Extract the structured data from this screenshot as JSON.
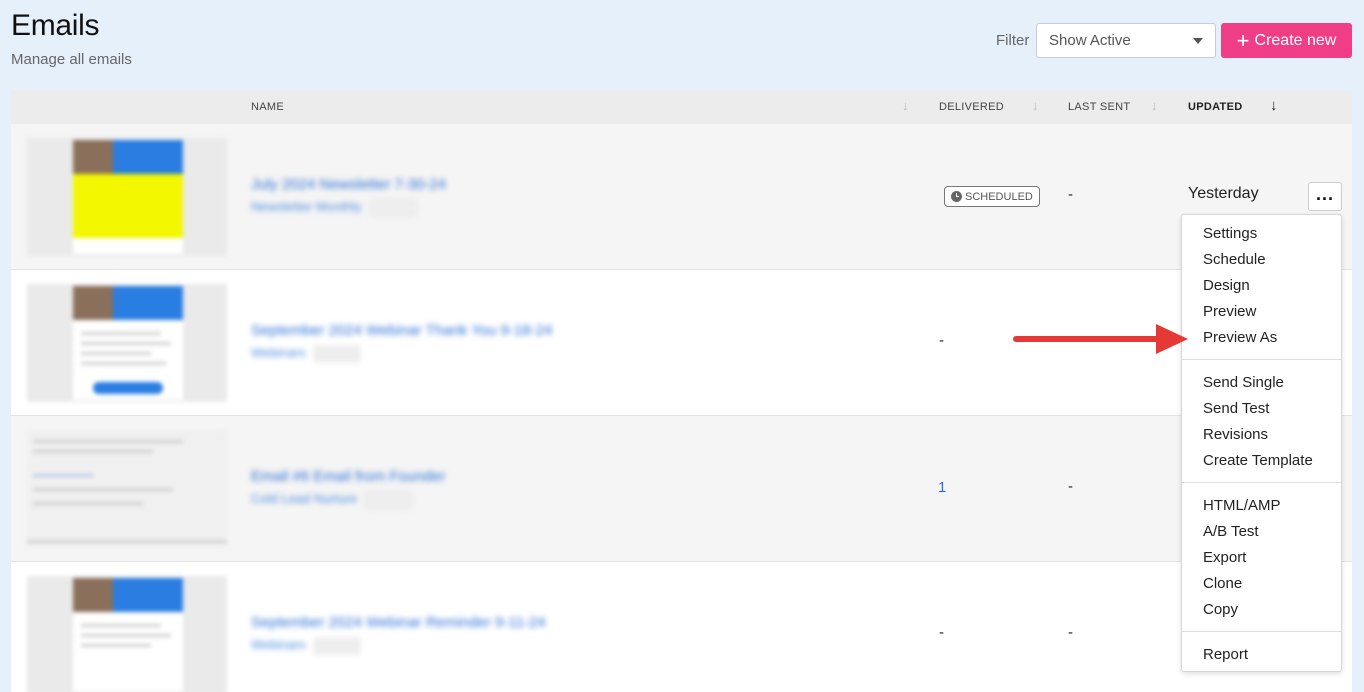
{
  "header": {
    "title": "Emails",
    "subtitle": "Manage all emails",
    "filter_label": "Filter",
    "filter_value": "Show Active",
    "create_label": "Create new"
  },
  "columns": {
    "name": "NAME",
    "delivered": "DELIVERED",
    "last_sent": "LAST SENT",
    "updated": "UPDATED"
  },
  "rows": [
    {
      "name": "July 2024 Newsletter 7-30-24",
      "folder": "Newsletter Monthly",
      "status": "SCHEDULED",
      "delivered": "",
      "last_sent": "-",
      "updated": "Yesterday"
    },
    {
      "name": "September 2024 Webinar Thank You 9-18-24",
      "folder": "Webinars",
      "delivered": "-",
      "last_sent": "",
      "updated": ""
    },
    {
      "name": "Email #6 Email from Founder",
      "folder": "Cold Lead Nurture",
      "delivered": "1",
      "last_sent": "-",
      "updated": ""
    },
    {
      "name": "September 2024 Webinar Reminder 9-11-24",
      "folder": "Webinars",
      "delivered": "-",
      "last_sent": "-",
      "updated": ""
    }
  ],
  "menu": {
    "group1": [
      "Settings",
      "Schedule",
      "Design",
      "Preview",
      "Preview As"
    ],
    "group2": [
      "Send Single",
      "Send Test",
      "Revisions",
      "Create Template"
    ],
    "group3": [
      "HTML/AMP",
      "A/B Test",
      "Export",
      "Clone",
      "Copy"
    ],
    "group4": [
      "Report"
    ]
  },
  "colors": {
    "accent": "#ef3e86",
    "link": "#2a6fd6",
    "annotation_arrow": "#e53935",
    "page_bg": "#e6f0fb"
  },
  "icons": {
    "more": "more-horizontal-icon",
    "sort": "arrow-down-icon",
    "clock": "clock-icon",
    "plus": "plus-icon",
    "caret": "caret-down-icon"
  }
}
